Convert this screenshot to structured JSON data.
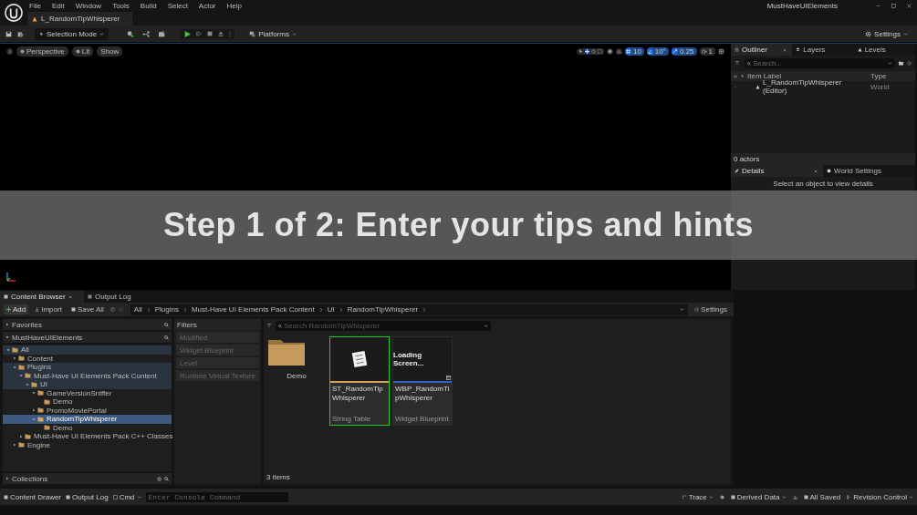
{
  "menu": [
    "File",
    "Edit",
    "Window",
    "Tools",
    "Build",
    "Select",
    "Actor",
    "Help"
  ],
  "window_title": "MustHaveUIElements",
  "level_tab": "L_RandomTipWhisperer",
  "toolbar": {
    "mode": "Selection Mode",
    "platforms": "Platforms",
    "settings": "Settings"
  },
  "viewport": {
    "buttons": [
      "Perspective",
      "Lit",
      "Show"
    ],
    "snaps": [
      {
        "label": "10",
        "on": true
      },
      {
        "label": "10°",
        "on": true
      },
      {
        "label": "0.25",
        "on": true
      }
    ],
    "camera_speed": "1"
  },
  "banner": "Step 1 of 2: Enter your tips and hints",
  "outliner": {
    "tabs": [
      {
        "label": "Outliner",
        "selected": true
      },
      {
        "label": "Layers",
        "selected": false
      },
      {
        "label": "Levels",
        "selected": false
      }
    ],
    "search_placeholder": "Search...",
    "columns": [
      "Item Label",
      "Type"
    ],
    "rows": [
      {
        "label": "L_RandomTipWhisperer (Editor)",
        "type": "World"
      }
    ],
    "footer": "0 actors"
  },
  "details": {
    "tabs": [
      {
        "label": "Details",
        "selected": true
      },
      {
        "label": "World Settings",
        "selected": false
      }
    ],
    "message": "Select an object to view details"
  },
  "content_browser": {
    "tabs": [
      {
        "label": "Content Browser",
        "selected": true
      },
      {
        "label": "Output Log",
        "selected": false
      }
    ],
    "add": "Add",
    "import": "Import",
    "save_all": "Save All",
    "breadcrumb": [
      "All",
      "Plugins",
      "Must-Have UI Elements Pack Content",
      "UI",
      "RandomTipWhisperer"
    ],
    "settings": "Settings",
    "favorites": "Favorites",
    "project": "MustHaveUIElements",
    "tree": [
      {
        "label": "All",
        "expanded": true,
        "selected": false,
        "highlighted": true,
        "children": [
          {
            "label": "Content",
            "expanded": false,
            "selected": false,
            "highlighted": false
          },
          {
            "label": "Plugins",
            "expanded": true,
            "selected": false,
            "highlighted": true,
            "children": [
              {
                "label": "Must-Have UI Elements Pack Content",
                "expanded": true,
                "selected": false,
                "highlighted": true,
                "children": [
                  {
                    "label": "UI",
                    "expanded": true,
                    "selected": false,
                    "highlighted": true,
                    "children": [
                      {
                        "label": "GameVersionSniffer",
                        "expanded": true,
                        "selected": false,
                        "highlighted": false,
                        "children": [
                          {
                            "label": "Demo",
                            "selected": false,
                            "highlighted": false
                          }
                        ]
                      },
                      {
                        "label": "PromoMoviePortal",
                        "expanded": false,
                        "selected": false,
                        "highlighted": false
                      },
                      {
                        "label": "RandomTipWhisperer",
                        "expanded": true,
                        "selected": true,
                        "highlighted": false,
                        "children": [
                          {
                            "label": "Demo",
                            "selected": false,
                            "highlighted": false
                          }
                        ]
                      }
                    ]
                  }
                ]
              },
              {
                "label": "Must-Have UI Elements Pack C++ Classes",
                "expanded": false,
                "selected": false,
                "highlighted": false
              }
            ]
          },
          {
            "label": "Engine",
            "expanded": false,
            "selected": false,
            "highlighted": false
          }
        ]
      }
    ],
    "collections": "Collections",
    "filters_title": "Filters",
    "filters": [
      "Modified",
      "Widget Blueprint",
      "Level",
      "Runtime Virtual Texture"
    ],
    "search_placeholder": "Search RandomTipWhisperer",
    "assets": [
      {
        "kind": "folder",
        "name": "Demo",
        "selected": false
      },
      {
        "kind": "string-table",
        "name": "ST_RandomTipWhisperer",
        "type": "String Table",
        "selected": true
      },
      {
        "kind": "widget",
        "name": "WBP_RandomTipWhisperer",
        "type": "Widget Blueprint",
        "thumbnail_text": "Loading Screen...",
        "selected": false
      }
    ],
    "count": "3 items"
  },
  "status_bar": {
    "left": [
      "Content Drawer",
      "Output Log"
    ],
    "cmd": "Cmd",
    "console_placeholder": "Enter Console Command",
    "trace": "Trace",
    "derived_data": "Derived Data",
    "saved": "All Saved",
    "revision": "Revision Control"
  }
}
